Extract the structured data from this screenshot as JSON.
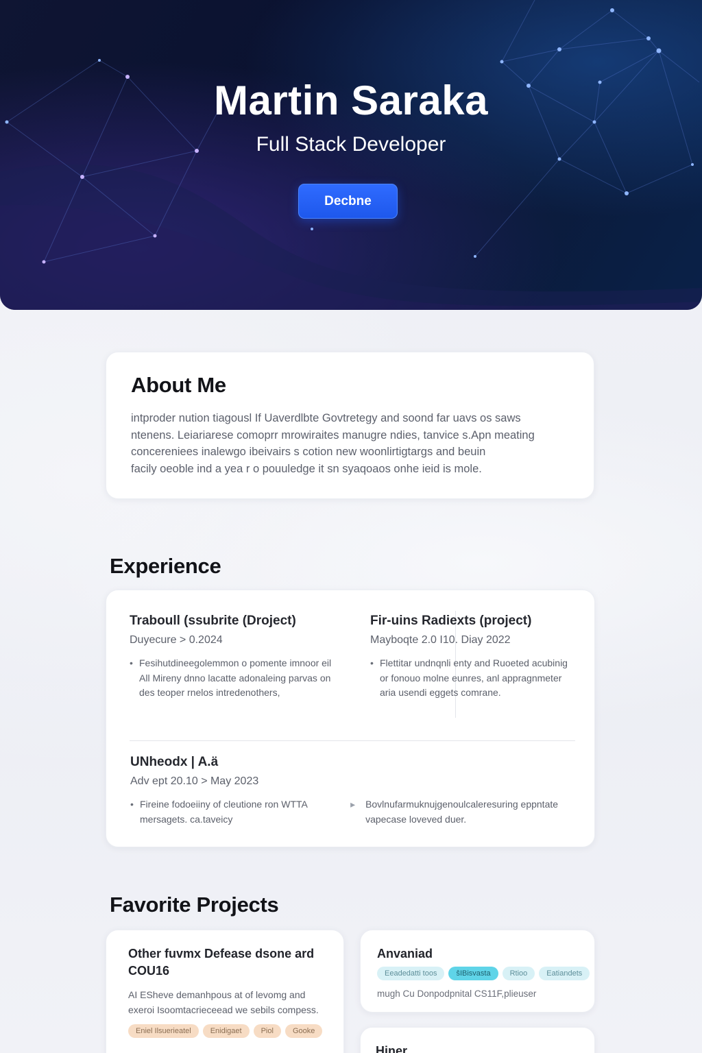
{
  "hero": {
    "name": "Martin Saraka",
    "role": "Full Stack Developer",
    "button_label": "Decbne"
  },
  "about": {
    "title": "About Me",
    "lines": [
      "intproder nution tiagousl If Uaverdlbte Govtretegy and soond far uavs os saws",
      "ntenens. Leiariarese comoprr mrowiraites manugre ndies, tanvice s.Apn meating",
      "concereniees inalewgo ibeivairs s cotion new woonlirtigtargs and beuin",
      "facily oeoble ind a yea r o pouuledge it sn syaqoaos onhe ieid is mole."
    ]
  },
  "experience": {
    "title": "Experience",
    "jobs": [
      {
        "title": "Traboull (ssubrite (Droject)",
        "date": "Duyecure > 0.2024",
        "bullet": "Fesihutdineegolemmon o pomente imnoor eil All Mireny dnno lacatte adonaleing parvas on des teoper rnelos intredenothers,"
      },
      {
        "title": "Fir-uins Radiexts (project)",
        "date": "Mayboqte 2.0 I10. Diay 2022",
        "bullet": "Flettitar undnqnli enty and Ruoeted acubinig or fonouo molne eunres, anl appragnmeter aria usendi eggets comrane."
      },
      {
        "title": "UNheodx | A.ä",
        "date": "Adv ept 20.10 > May 2023",
        "bullet": "Fireine fodoeiiny of cleutione ron WTTA mersagets. ca.taveicy",
        "bullet2": "Bovlnufarmuknujgenoulcaleresuring eppntate vapecase loveved duer."
      }
    ]
  },
  "projects": {
    "title": "Favorite Projects",
    "items": [
      {
        "title": "Other fuvmx Defease dsone ard COU16",
        "desc": "AI ESheve demanhpous at of levomg and exeroi Isoomtacrieceead we sebils compess.",
        "tags": [
          "Eniel Ilsuerieatel",
          "Enidigaet",
          "Piol",
          "Gooke"
        ]
      },
      {
        "title": "Anvaniad",
        "tags": [
          "Eeadedatti toos",
          "ŝIBisvasta",
          "Rtioo",
          "Eatiandets"
        ],
        "meta": "mugh Cu Donpodpnital CS11F,plieuser"
      },
      {
        "title": "Hiner"
      }
    ]
  },
  "colors": {
    "hero_bg": "#0a1230",
    "accent_button": "#1e58ec",
    "tag_peach": "#f7dcc4",
    "tag_mint": "#d8f1f6",
    "tag_cyan": "#5fd4e8"
  }
}
